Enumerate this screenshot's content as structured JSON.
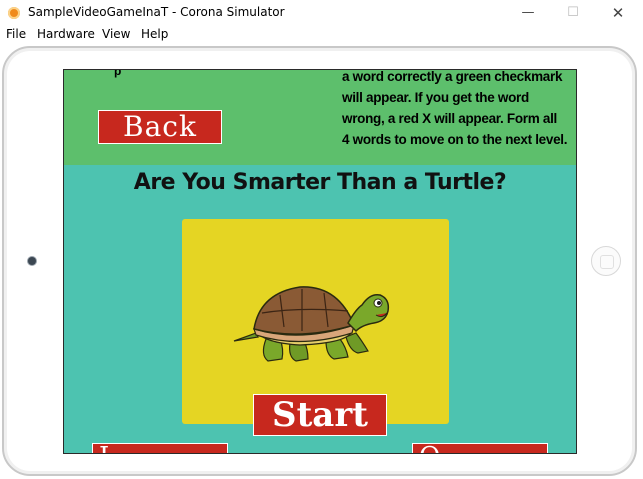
{
  "window": {
    "title": "SampleVideoGameInaT - Corona Simulator",
    "controls": {
      "minimize": "—",
      "maximize": "☐",
      "close": "✕"
    }
  },
  "menubar": {
    "items": [
      "File",
      "Hardware",
      "View",
      "Help"
    ]
  },
  "game": {
    "instructions_lines": [
      "a word correctly a green checkmark",
      "will appear. If you get the word",
      "wrong, a red X will appear. Form all",
      "4 words to move on to the next level."
    ],
    "back_label": "Back",
    "headline": "Are You Smarter Than a Turtle?",
    "start_label": "Start",
    "bottom_left_label": "I...",
    "bottom_right_label": "O..."
  },
  "colors": {
    "top_band": "#5dbf6c",
    "screen_bg": "#4dc3b0",
    "panel": "#e5d523",
    "button": "#c7281e"
  },
  "icons": {
    "app": "corona-app-icon",
    "home": "device-home-button",
    "camera": "device-camera"
  }
}
